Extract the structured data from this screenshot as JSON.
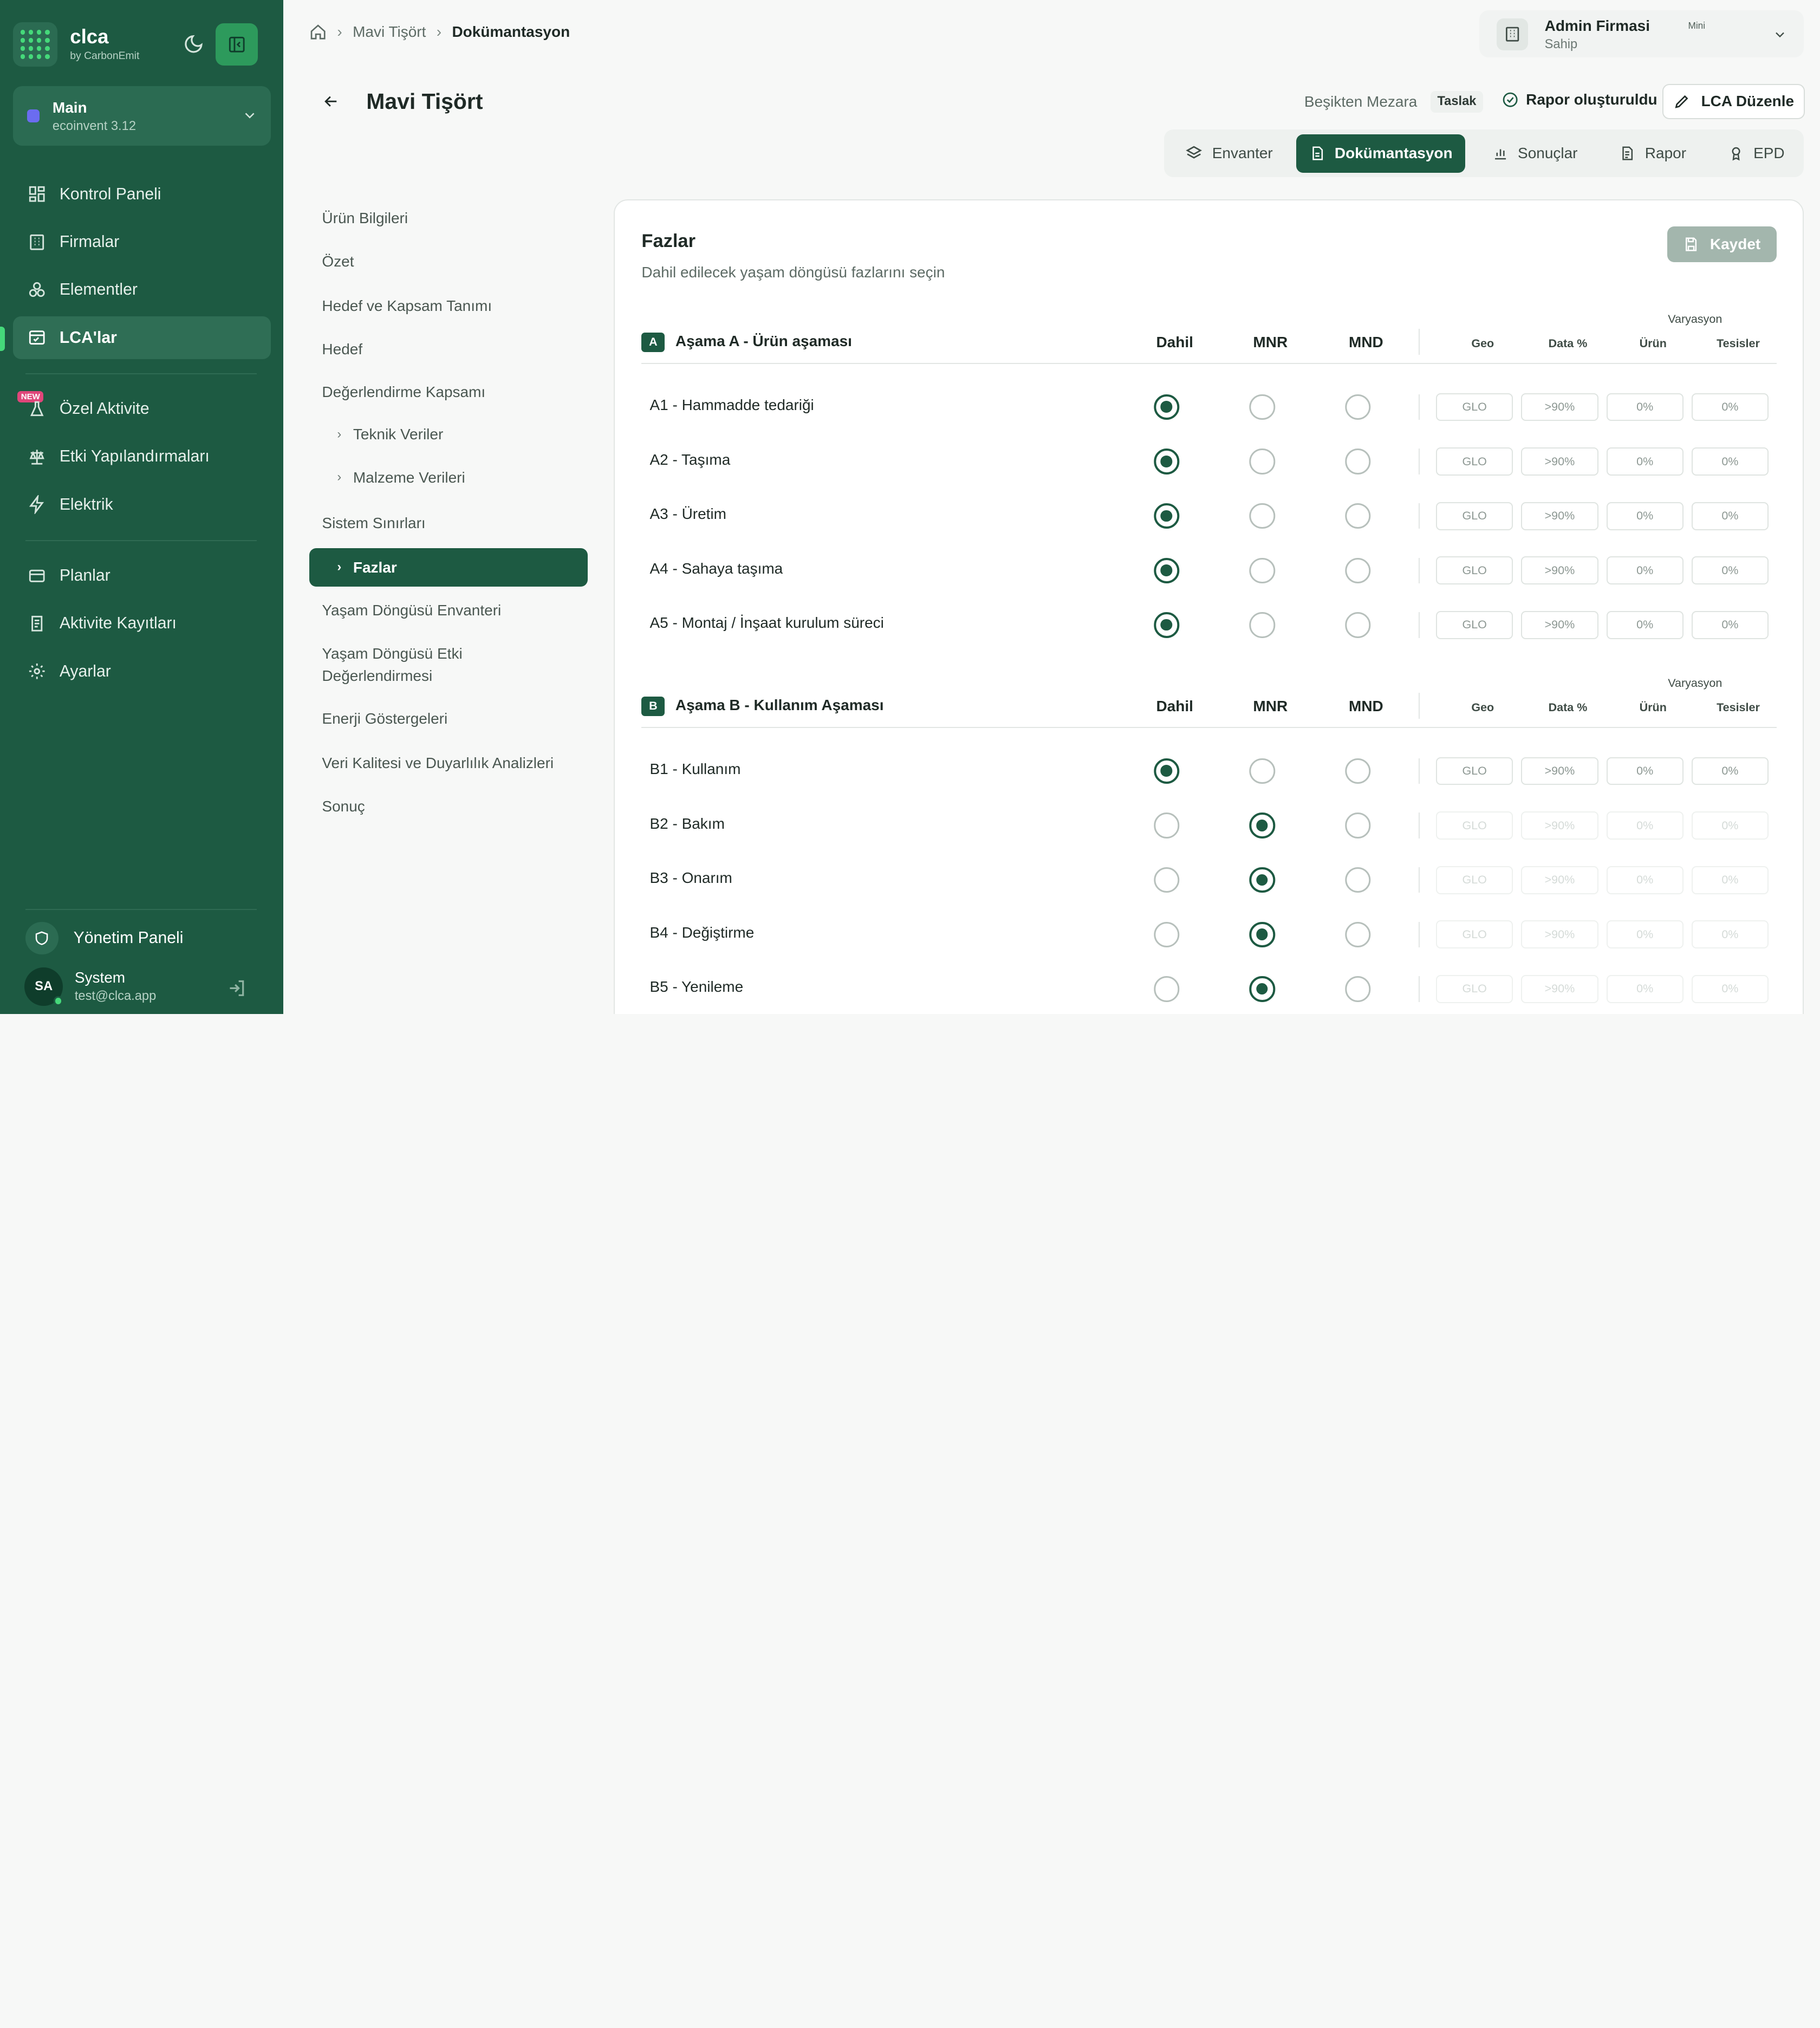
{
  "brand": {
    "name": "clca",
    "sub": "by CarbonEmit"
  },
  "workspace": {
    "name": "Main",
    "sub": "ecoinvent 3.12"
  },
  "nav": {
    "items": [
      {
        "label": "Kontrol Paneli",
        "icon": "dashboard-icon"
      },
      {
        "label": "Firmalar",
        "icon": "building-icon"
      },
      {
        "label": "Elementler",
        "icon": "elements-icon"
      },
      {
        "label": "LCA'lar",
        "icon": "lca-icon"
      },
      {
        "label": "Özel Aktivite",
        "icon": "flask-icon",
        "badge": "NEW"
      },
      {
        "label": "Etki Yapılandırmaları",
        "icon": "scale-icon"
      },
      {
        "label": "Elektrik",
        "icon": "bolt-icon"
      },
      {
        "label": "Planlar",
        "icon": "card-icon"
      },
      {
        "label": "Aktivite Kayıtları",
        "icon": "log-icon"
      },
      {
        "label": "Ayarlar",
        "icon": "gear-icon"
      }
    ]
  },
  "admin": {
    "label": "Yönetim Paneli"
  },
  "user": {
    "initials": "SA",
    "name": "System",
    "email": "test@clca.app"
  },
  "breadcrumb": {
    "level1": "Mavi Tişört",
    "level2": "Dokümantasyon"
  },
  "org": {
    "name": "Admin Firmasi",
    "plan": "Mini",
    "role": "Sahip"
  },
  "page": {
    "title": "Mavi Tişört",
    "scope": "Beşikten Mezara",
    "status": "Taslak",
    "report_status": "Rapor oluşturuldu",
    "edit_label": "LCA Düzenle"
  },
  "tabs": [
    {
      "label": "Envanter"
    },
    {
      "label": "Dokümantasyon"
    },
    {
      "label": "Sonuçlar"
    },
    {
      "label": "Rapor"
    },
    {
      "label": "EPD"
    }
  ],
  "sections": {
    "urun": "Ürün Bilgileri",
    "ozet": "Özet",
    "hedef_kapsam": "Hedef ve Kapsam Tanımı",
    "hedef": "Hedef",
    "degerlendirme": "Değerlendirme Kapsamı",
    "teknik": "Teknik Veriler",
    "malzeme": "Malzeme Verileri",
    "sistem": "Sistem Sınırları",
    "fazlar": "Fazlar",
    "envanter": "Yaşam Döngüsü Envanteri",
    "etki1": "Yaşam Döngüsü Etki",
    "etki2": "Değerlendirmesi",
    "enerji": "Enerji Göstergeleri",
    "veri": "Veri Kalitesi ve Duyarlılık Analizleri",
    "sonuc": "Sonuç"
  },
  "panel": {
    "title": "Fazlar",
    "subtitle": "Dahil edilecek yaşam döngüsü fazlarını seçin",
    "save_label": "Kaydet"
  },
  "columns": {
    "dahil": "Dahil",
    "mnr": "MNR",
    "mnd": "MND",
    "variation": "Varyasyon",
    "geo": "Geo",
    "data": "Data %",
    "urun": "Ürün",
    "tesisler": "Tesisler"
  },
  "stageA": {
    "badge": "A",
    "title": "Aşama A - Ürün aşaması",
    "rows": [
      {
        "label": "A1 - Hammadde tedariği",
        "geo": "GLO",
        "data": ">90%",
        "urun": "0%",
        "tesisler": "0%"
      },
      {
        "label": "A2 - Taşıma",
        "geo": "GLO",
        "data": ">90%",
        "urun": "0%",
        "tesisler": "0%"
      },
      {
        "label": "A3 - Üretim",
        "geo": "GLO",
        "data": ">90%",
        "urun": "0%",
        "tesisler": "0%"
      },
      {
        "label": "A4 - Sahaya taşıma",
        "geo": "GLO",
        "data": ">90%",
        "urun": "0%",
        "tesisler": "0%"
      },
      {
        "label": "A5 - Montaj / İnşaat kurulum süreci",
        "geo": "GLO",
        "data": ">90%",
        "urun": "0%",
        "tesisler": "0%"
      }
    ]
  },
  "stageB": {
    "badge": "B",
    "title": "Aşama B - Kullanım Aşaması",
    "rows": [
      {
        "label": "B1 - Kullanım",
        "geo": "GLO",
        "data": ">90%",
        "urun": "0%",
        "tesisler": "0%"
      },
      {
        "label": "B2 - Bakım",
        "geo": "GLO",
        "data": ">90%",
        "urun": "0%",
        "tesisler": "0%"
      },
      {
        "label": "B3 - Onarım",
        "geo": "GLO",
        "data": ">90%",
        "urun": "0%",
        "tesisler": "0%"
      },
      {
        "label": "B4 - Değiştirme",
        "geo": "GLO",
        "data": ">90%",
        "urun": "0%",
        "tesisler": "0%"
      },
      {
        "label": "B5 - Yenileme",
        "geo": "GLO",
        "data": ">90%",
        "urun": "0%",
        "tesisler": "0%"
      }
    ]
  },
  "colors": {
    "primary": "#1d5a42",
    "accent": "#45d97a",
    "new_badge": "#e0467a"
  }
}
